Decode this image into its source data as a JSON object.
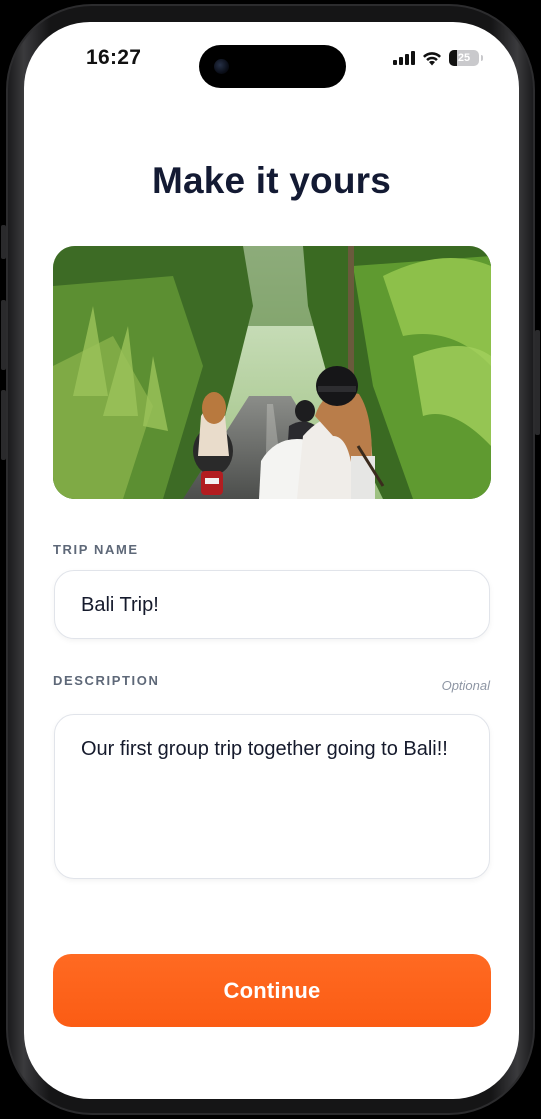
{
  "status_bar": {
    "time": "16:27",
    "battery": "25",
    "battery_level": 0.25
  },
  "page": {
    "title": "Make it yours"
  },
  "trip_name": {
    "label": "TRIP NAME",
    "value": "Bali Trip!"
  },
  "description": {
    "label": "DESCRIPTION",
    "optional_label": "Optional",
    "value": "Our first group trip together going to Bali!!"
  },
  "continue_button": {
    "label": "Continue"
  },
  "colors": {
    "accent": "#FB5C14",
    "title": "#131A33",
    "label": "#5E6878"
  },
  "icons": {
    "signal": "cellular-signal-icon",
    "wifi": "wifi-icon",
    "battery": "battery-icon"
  }
}
